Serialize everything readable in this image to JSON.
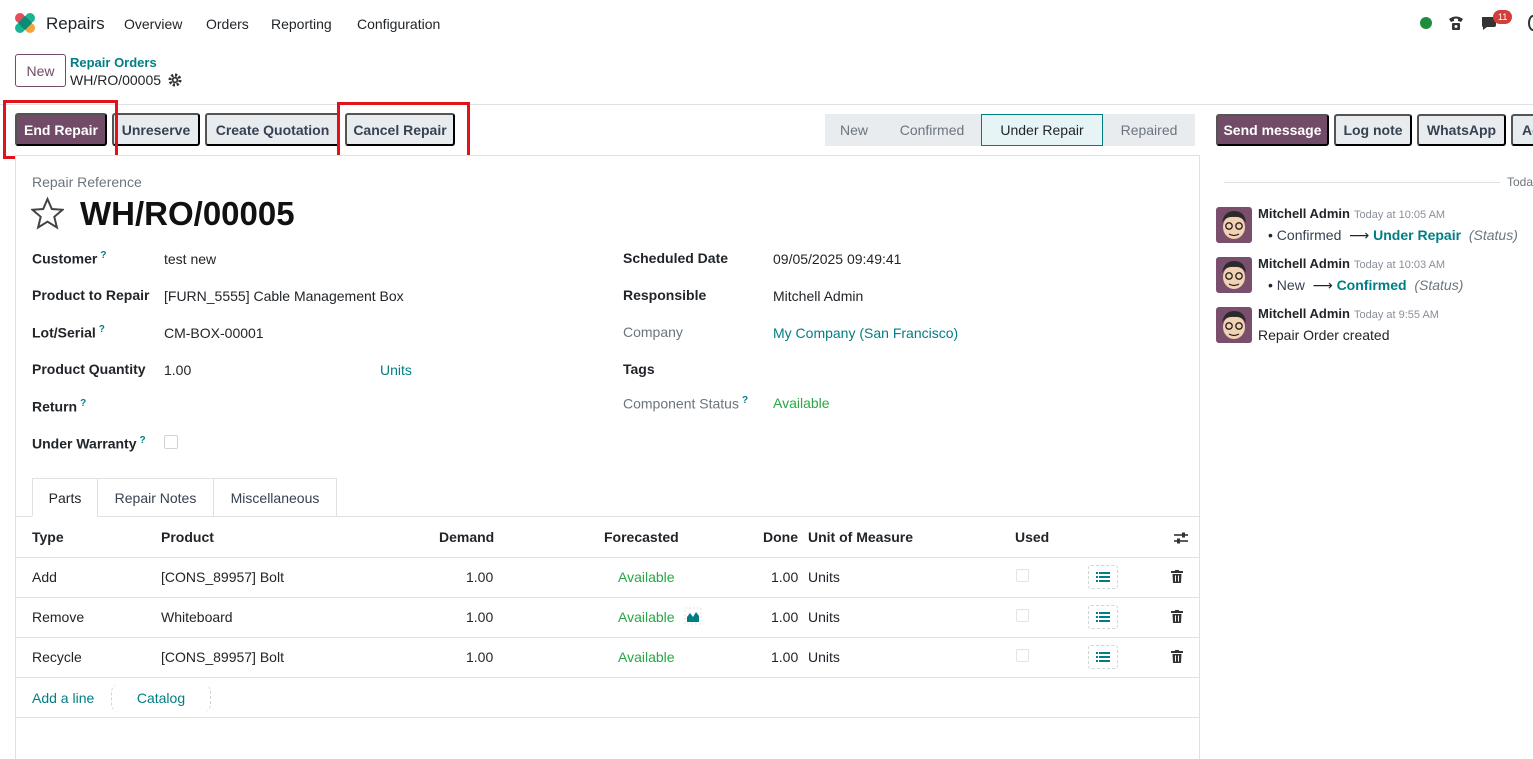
{
  "app": {
    "name": "Repairs"
  },
  "nav": [
    "Overview",
    "Orders",
    "Reporting",
    "Configuration"
  ],
  "notifications": {
    "count": "11"
  },
  "breadcrumb": {
    "new_label": "New",
    "parent": "Repair Orders",
    "current": "WH/RO/00005"
  },
  "actions": {
    "end_repair": "End Repair",
    "unreserve": "Unreserve",
    "create_quotation": "Create Quotation",
    "cancel_repair": "Cancel Repair"
  },
  "stages": [
    {
      "label": "New",
      "active": false
    },
    {
      "label": "Confirmed",
      "active": false
    },
    {
      "label": "Under Repair",
      "active": true
    },
    {
      "label": "Repaired",
      "active": false
    }
  ],
  "chatter_buttons": {
    "send_message": "Send message",
    "log_note": "Log note",
    "whatsapp": "WhatsApp",
    "activities": "Ac"
  },
  "form": {
    "reference_label": "Repair Reference",
    "reference": "WH/RO/00005",
    "customer": {
      "label": "Customer",
      "value": "test new"
    },
    "product": {
      "label": "Product to Repair",
      "value": "[FURN_5555] Cable Management Box"
    },
    "lot": {
      "label": "Lot/Serial",
      "value": "CM-BOX-00001"
    },
    "quantity": {
      "label": "Product Quantity",
      "value": "1.00",
      "uom": "Units"
    },
    "return": {
      "label": "Return"
    },
    "warranty": {
      "label": "Under Warranty"
    },
    "scheduled": {
      "label": "Scheduled Date",
      "value": "09/05/2025 09:49:41"
    },
    "responsible": {
      "label": "Responsible",
      "value": "Mitchell Admin"
    },
    "company": {
      "label": "Company",
      "value": "My Company (San Francisco)"
    },
    "tags": {
      "label": "Tags"
    },
    "component_status": {
      "label": "Component Status",
      "value": "Available"
    },
    "help_mark": "?"
  },
  "tabs": [
    "Parts",
    "Repair Notes",
    "Miscellaneous"
  ],
  "table": {
    "headers": {
      "type": "Type",
      "product": "Product",
      "demand": "Demand",
      "forecasted": "Forecasted",
      "done": "Done",
      "uom": "Unit of Measure",
      "used": "Used"
    },
    "rows": [
      {
        "type": "Add",
        "product": "[CONS_89957] Bolt",
        "demand": "1.00",
        "forecasted": "Available",
        "done": "1.00",
        "uom": "Units"
      },
      {
        "type": "Remove",
        "product": "Whiteboard",
        "demand": "1.00",
        "forecasted": "Available",
        "done": "1.00",
        "uom": "Units"
      },
      {
        "type": "Recycle",
        "product": "[CONS_89957] Bolt",
        "demand": "1.00",
        "forecasted": "Available",
        "done": "1.00",
        "uom": "Units"
      }
    ],
    "add_line": "Add a line",
    "catalog": "Catalog"
  },
  "chatter": {
    "date_separator": "Toda",
    "messages": [
      {
        "author": "Mitchell Admin",
        "time": "Today at 10:05 AM",
        "old": "Confirmed",
        "new": "Under Repair",
        "field": "(Status)"
      },
      {
        "author": "Mitchell Admin",
        "time": "Today at 10:03 AM",
        "old": "New",
        "new": "Confirmed",
        "field": "(Status)"
      },
      {
        "author": "Mitchell Admin",
        "time": "Today at 9:55 AM",
        "body": "Repair Order created"
      }
    ]
  },
  "colors": {
    "primary": "#714b67",
    "link": "#017e84",
    "success": "#28a745",
    "highlight": "#e0121b"
  }
}
